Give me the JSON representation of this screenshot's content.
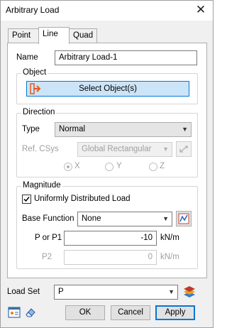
{
  "window": {
    "title": "Arbitrary Load"
  },
  "tabs": [
    {
      "label": "Point"
    },
    {
      "label": "Line"
    },
    {
      "label": "Quad"
    }
  ],
  "name": {
    "label": "Name",
    "value": "Arbitrary Load-1"
  },
  "object": {
    "group_title": "Object",
    "select_button_label": "Select Object(s)"
  },
  "direction": {
    "group_title": "Direction",
    "type_label": "Type",
    "type_value": "Normal",
    "ref_csys_label": "Ref. CSys",
    "ref_csys_value": "Global Rectangular",
    "axes": [
      {
        "label": "X",
        "selected": true
      },
      {
        "label": "Y",
        "selected": false
      },
      {
        "label": "Z",
        "selected": false
      }
    ]
  },
  "magnitude": {
    "group_title": "Magnitude",
    "udl_label": "Uniformly Distributed Load",
    "udl_checked": true,
    "base_function_label": "Base Function",
    "base_function_value": "None",
    "p1_label": "P or P1",
    "p1_value": "-10",
    "p1_unit": "kN/m",
    "p2_label": "P2",
    "p2_value": "0",
    "p2_unit": "kN/m"
  },
  "load_set": {
    "label": "Load Set",
    "value": "P"
  },
  "footer": {
    "ok_label": "OK",
    "cancel_label": "Cancel",
    "apply_label": "Apply"
  },
  "colors": {
    "accent": "#0078d7",
    "select_button_bg": "#cce4f7",
    "arrow_icon": "#e8581c"
  }
}
